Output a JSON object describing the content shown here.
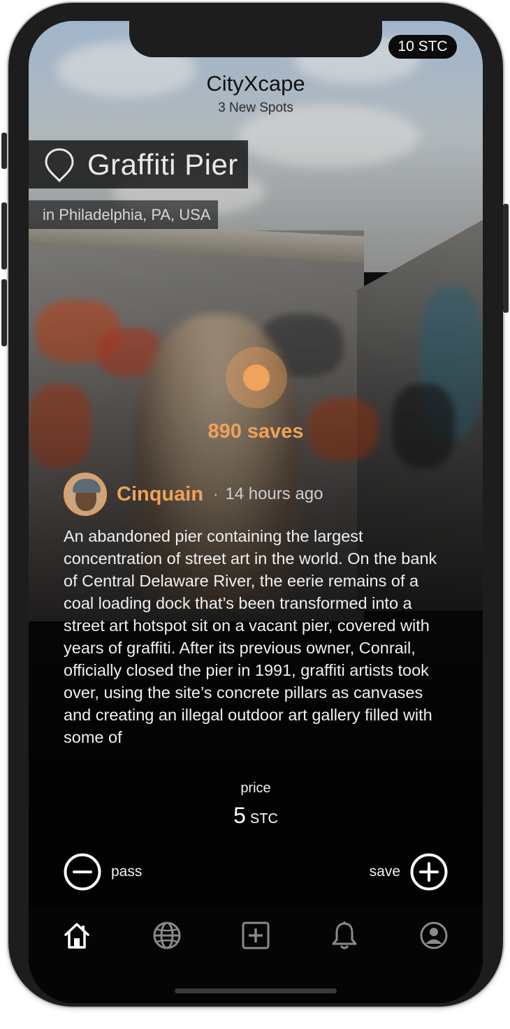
{
  "status": {
    "balance": "10 STC"
  },
  "header": {
    "app_name": "CityXcape",
    "subtitle": "3 New Spots"
  },
  "spot": {
    "title": "Graffiti Pier",
    "location": "in Philadelphia, PA, USA",
    "saves": "890 saves"
  },
  "post": {
    "author": "Cinquain",
    "separator": "·",
    "time": "14 hours ago",
    "description": "An abandoned pier containing the largest concentration of street art in the world. On the bank of Central Delaware River, the eerie remains of a coal loading dock that’s been transformed into a street art hotspot sit on a vacant pier, covered with years of graffiti. After its previous owner, Conrail, officially closed the pier in 1991, graffiti artists took over, using the site’s concrete pillars as canvases and creating an illegal outdoor art gallery filled with some of"
  },
  "price": {
    "label": "price",
    "value": "5",
    "unit": "STC"
  },
  "actions": {
    "pass_label": "pass",
    "save_label": "save"
  },
  "tabs": [
    {
      "icon": "home-icon",
      "active": true
    },
    {
      "icon": "globe-icon",
      "active": false
    },
    {
      "icon": "add-square-icon",
      "active": false
    },
    {
      "icon": "bell-icon",
      "active": false
    },
    {
      "icon": "profile-icon",
      "active": false
    }
  ],
  "colors": {
    "accent": "#efa159",
    "tab_active": "#ffffff",
    "tab_inactive": "#8a8a8a"
  }
}
